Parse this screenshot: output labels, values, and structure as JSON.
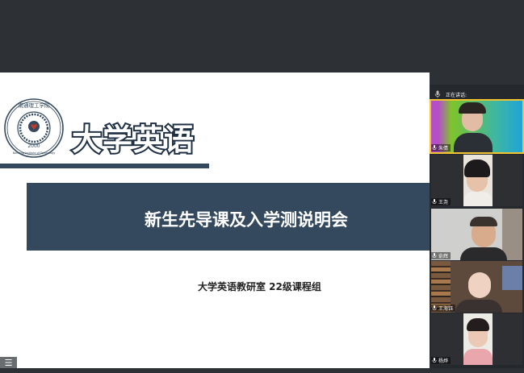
{
  "slide": {
    "logo_text": "南通理工学院",
    "logo_english": "Nantong Institute of Technology",
    "logo_year": "2000",
    "course_title": "大学英语",
    "banner_title": "新生先导课及入学测说明会",
    "subtitle": "大学英语教研室 22级课程组"
  },
  "panel": {
    "speaking_label": "正在讲话:",
    "participants": [
      {
        "name": "朱倩",
        "active": true
      },
      {
        "name": "王尧",
        "active": false
      },
      {
        "name": "俞辉",
        "active": false
      },
      {
        "name": "王海钰",
        "active": false
      },
      {
        "name": "杨烨",
        "active": false
      }
    ]
  },
  "colors": {
    "slide_accent": "#34495e",
    "app_background": "#2d3035",
    "active_speaker_border": "#f2c230"
  },
  "icons": {
    "menu": "menu-icon",
    "mic": "microphone-icon"
  }
}
